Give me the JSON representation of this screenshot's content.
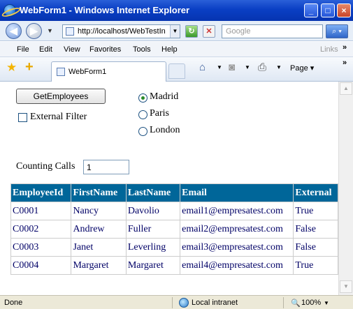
{
  "window": {
    "title": "WebForm1 - Windows Internet Explorer"
  },
  "address_bar": {
    "url": "http://localhost/WebTestIn",
    "search_placeholder": "Google"
  },
  "menu": [
    "File",
    "Edit",
    "View",
    "Favorites",
    "Tools",
    "Help"
  ],
  "links_label": "Links",
  "tab": {
    "title": "WebForm1"
  },
  "toolbar": {
    "page_label": "Page"
  },
  "form": {
    "button_label": "GetEmployees",
    "checkbox_label": "External Filter",
    "checkbox_checked": false,
    "radios": [
      {
        "label": "Madrid",
        "checked": true
      },
      {
        "label": "Paris",
        "checked": false
      },
      {
        "label": "London",
        "checked": false
      }
    ],
    "counting_label": "Counting Calls",
    "counting_value": "1"
  },
  "table": {
    "headers": [
      "EmployeeId",
      "FirstName",
      "LastName",
      "Email",
      "External"
    ],
    "rows": [
      [
        "C0001",
        "Nancy",
        "Davolio",
        "email1@empresatest.com",
        "True"
      ],
      [
        "C0002",
        "Andrew",
        "Fuller",
        "email2@empresatest.com",
        "False"
      ],
      [
        "C0003",
        "Janet",
        "Leverling",
        "email3@empresatest.com",
        "False"
      ],
      [
        "C0004",
        "Margaret",
        "Margaret",
        "email4@empresatest.com",
        "True"
      ]
    ]
  },
  "status": {
    "text": "Done",
    "zone": "Local intranet",
    "zoom": "100%"
  },
  "colors": {
    "header_bg": "#006699",
    "cell_text": "#000066",
    "titlebar": "#0a3fc4"
  }
}
